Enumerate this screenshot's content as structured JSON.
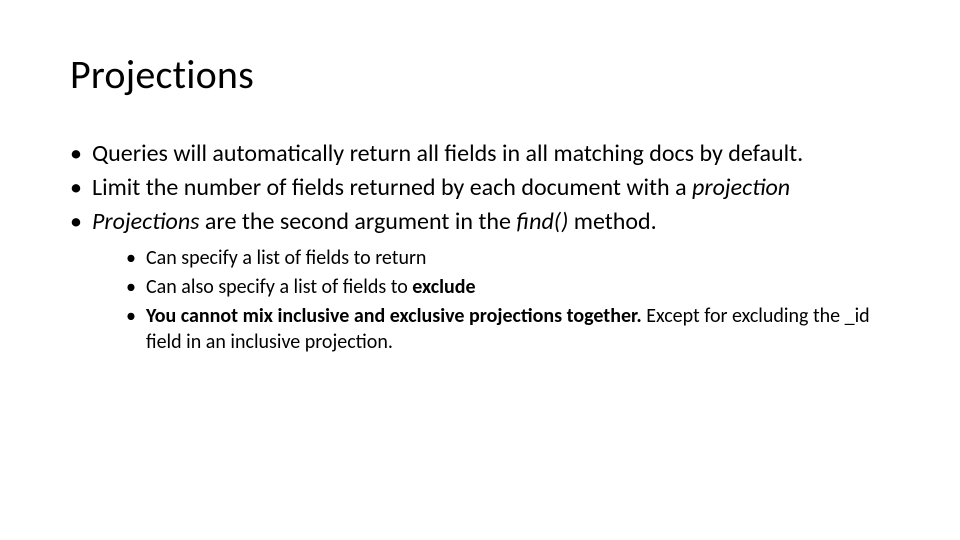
{
  "title": "Projections",
  "b1_a": "Queries will automatically return all fields in all matching docs by default.",
  "b2_a": "Limit the number of fields returned by each document with a ",
  "b2_b": "projection",
  "b3_a": "Projections",
  "b3_b": " are the second argument in the ",
  "b3_c": "find()",
  "b3_d": " method.",
  "s1_a": "Can specify a list of fields to return",
  "s2_a": "Can also specify a list of fields to ",
  "s2_b": "exclude",
  "s3_a": "You cannot mix inclusive and exclusive projections together.",
  "s3_b": " Except for excluding the _id field in an inclusive projection."
}
